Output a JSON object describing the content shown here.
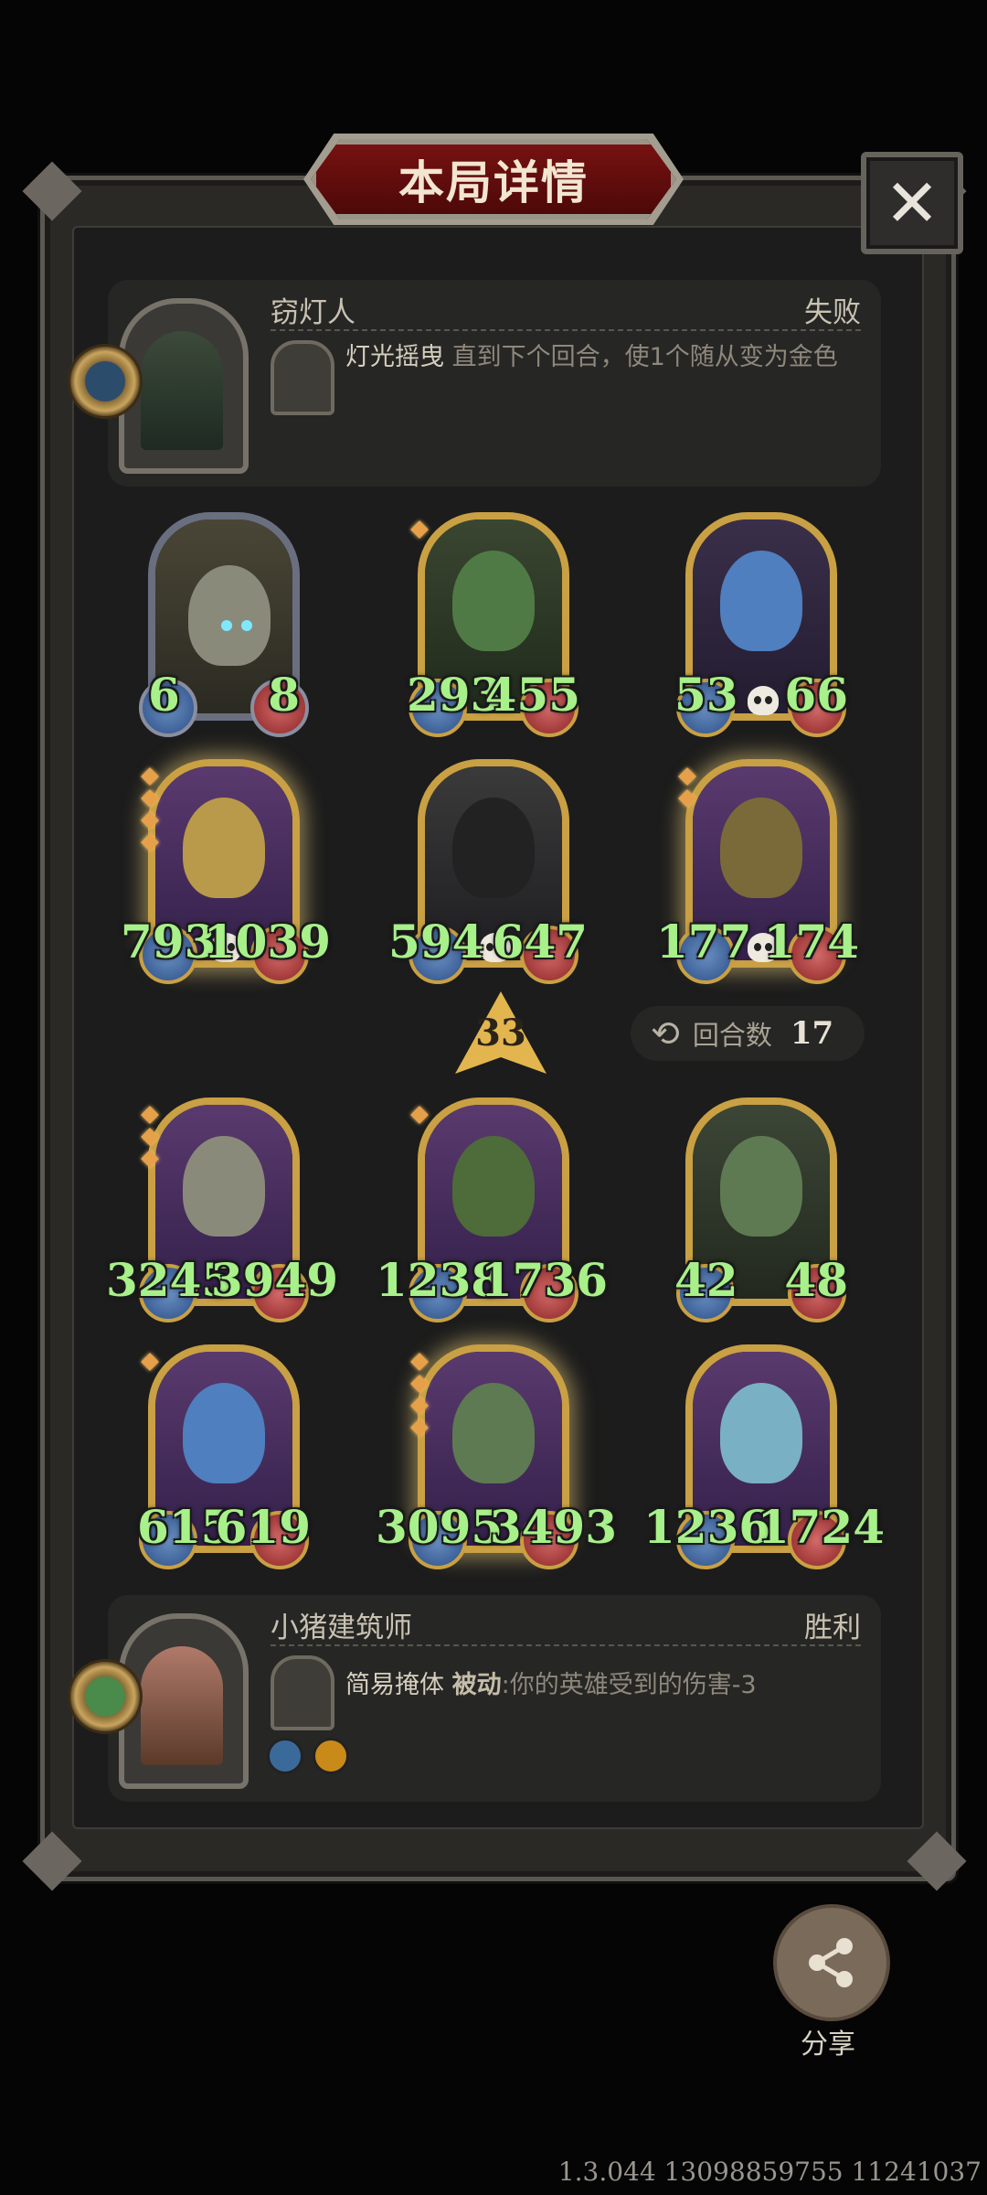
{
  "title": "本局详情",
  "close_label": "✕",
  "opponent": {
    "name": "窃灯人",
    "result": "失败",
    "skill_name": "灯光摇曳",
    "skill_desc": "直到下个回合，使1个随从变为金色"
  },
  "opponent_board": [
    {
      "attack": "6",
      "health": "8",
      "skull": false
    },
    {
      "attack": "293",
      "health": "455",
      "skull": false
    },
    {
      "attack": "53",
      "health": "66",
      "skull": true
    },
    {
      "attack": "793",
      "health": "1039",
      "skull": true
    },
    {
      "attack": "594",
      "health": "647",
      "skull": true
    },
    {
      "attack": "177",
      "health": "174",
      "skull": true
    }
  ],
  "tier": "33",
  "turns": {
    "label": "回合数",
    "value": "17"
  },
  "player_board": [
    {
      "attack": "3245",
      "health": "3949",
      "skull": false
    },
    {
      "attack": "1238",
      "health": "1736",
      "skull": false
    },
    {
      "attack": "42",
      "health": "48",
      "skull": false
    },
    {
      "attack": "615",
      "health": "619",
      "skull": false
    },
    {
      "attack": "3095",
      "health": "3493",
      "skull": false
    },
    {
      "attack": "1236",
      "health": "1724",
      "skull": false
    }
  ],
  "player": {
    "name": "小猪建筑师",
    "result": "胜利",
    "skill_name": "简易掩体",
    "skill_keyword": "被动",
    "skill_desc": ":你的英雄受到的伤害-3"
  },
  "share_label": "分享",
  "version_text": "1.3.044 13098859755 11241037",
  "colors": {
    "stat_green": "#a8f08a",
    "gold_frame": "#c9a043",
    "banner_red": "#7a1212"
  }
}
